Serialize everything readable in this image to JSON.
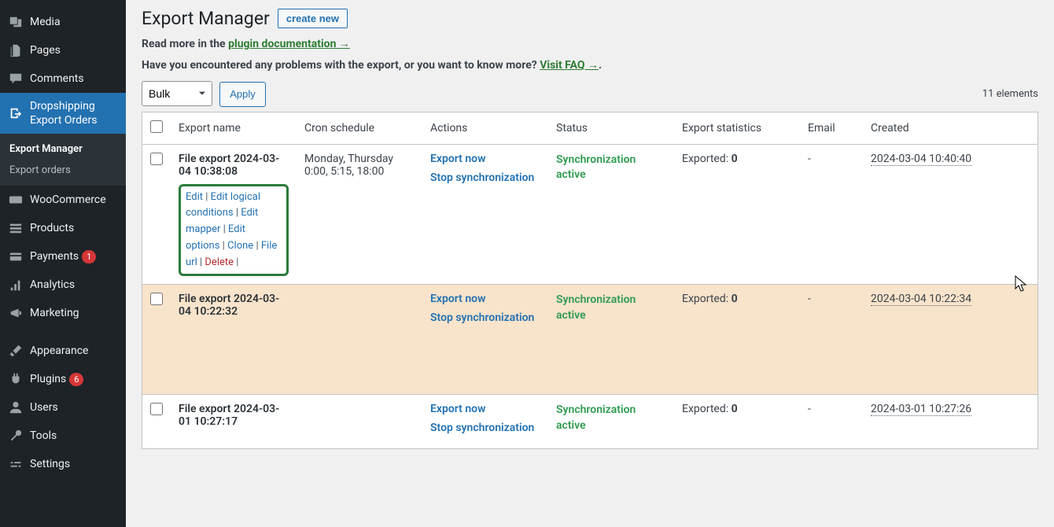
{
  "sidebar": {
    "items": [
      {
        "label": "Media",
        "icon": "media"
      },
      {
        "label": "Pages",
        "icon": "pages"
      },
      {
        "label": "Comments",
        "icon": "comments"
      },
      {
        "label": "Dropshipping Export Orders",
        "icon": "export",
        "active": true
      },
      {
        "label": "WooCommerce",
        "icon": "woo"
      },
      {
        "label": "Products",
        "icon": "products"
      },
      {
        "label": "Payments",
        "icon": "payments",
        "badge": "1"
      },
      {
        "label": "Analytics",
        "icon": "analytics"
      },
      {
        "label": "Marketing",
        "icon": "marketing"
      },
      {
        "label": "Appearance",
        "icon": "appearance"
      },
      {
        "label": "Plugins",
        "icon": "plugins",
        "badge": "6"
      },
      {
        "label": "Users",
        "icon": "users"
      },
      {
        "label": "Tools",
        "icon": "tools"
      },
      {
        "label": "Settings",
        "icon": "settings"
      }
    ],
    "submenu": [
      {
        "label": "Export Manager",
        "current": true
      },
      {
        "label": "Export orders"
      }
    ]
  },
  "header": {
    "title": "Export Manager",
    "create_label": "create new"
  },
  "intro": {
    "line1_pre": "Read more in the ",
    "line1_link": "plugin documentation →",
    "line2_pre": "Have you encountered any problems with the export, or you want to know more? ",
    "line2_link": "Visit FAQ →",
    "line2_post": "."
  },
  "controls": {
    "bulk_label": "Bulk",
    "apply_label": "Apply",
    "count_text": "11 elements"
  },
  "table": {
    "headers": {
      "name": "Export name",
      "cron": "Cron schedule",
      "actions": "Actions",
      "status": "Status",
      "stats": "Export statistics",
      "email": "Email",
      "created": "Created"
    },
    "rows": [
      {
        "name": "File export 2024-03-04 10:38:08",
        "cron": "Monday, Thursday 0:00, 5:15, 18:00",
        "actions": {
          "export": "Export now",
          "stop": "Stop synchronization"
        },
        "status": "Synchronization active",
        "stats_label": "Exported: ",
        "stats_value": "0",
        "email": "-",
        "created": "2024-03-04 10:40:40",
        "row_actions": {
          "edit": "Edit",
          "edit_logical": "Edit logical conditions",
          "edit_mapper": "Edit mapper",
          "edit_options": "Edit options",
          "clone": "Clone",
          "file_url": "File url",
          "delete": "Delete"
        }
      },
      {
        "name": "File export 2024-03-04 10:22:32",
        "cron": "",
        "actions": {
          "export": "Export now",
          "stop": "Stop synchronization"
        },
        "status": "Synchronization active",
        "stats_label": "Exported: ",
        "stats_value": "0",
        "email": "-",
        "created": "2024-03-04 10:22:34"
      },
      {
        "name": "File export 2024-03-01 10:27:17",
        "cron": "",
        "actions": {
          "export": "Export now",
          "stop": "Stop synchronization"
        },
        "status": "Synchronization active",
        "stats_label": "Exported: ",
        "stats_value": "0",
        "email": "-",
        "created": "2024-03-01 10:27:26"
      }
    ]
  }
}
